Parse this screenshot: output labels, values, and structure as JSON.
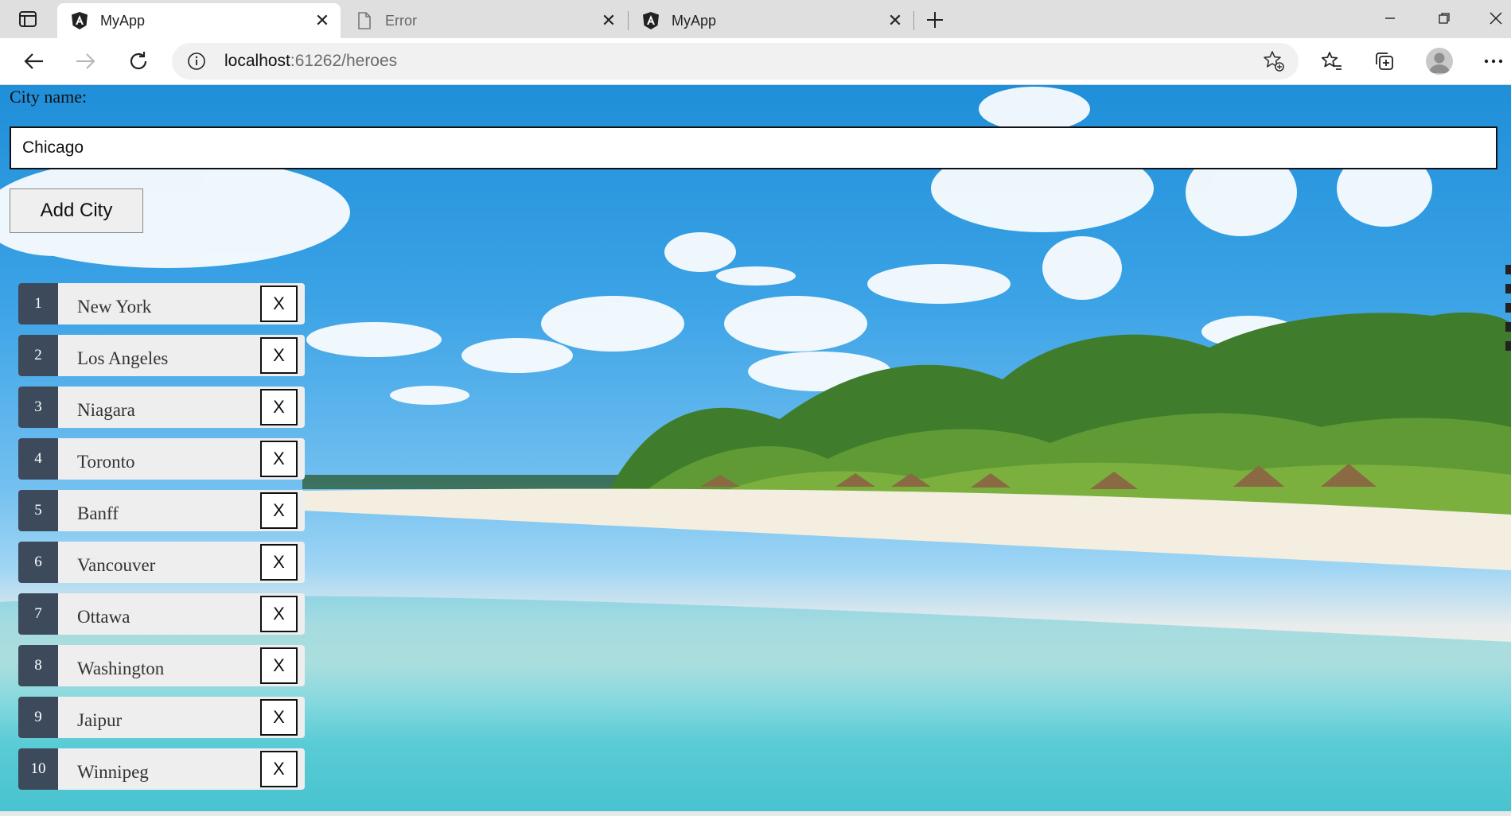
{
  "browser": {
    "tabs": [
      {
        "title": "MyApp",
        "icon": "angular-icon",
        "active": true
      },
      {
        "title": "Error",
        "icon": "page-icon",
        "active": false
      },
      {
        "title": "MyApp",
        "icon": "angular-icon",
        "active": false
      }
    ],
    "close_glyph": "✕",
    "url_host": "localhost",
    "url_rest": ":61262/heroes"
  },
  "page": {
    "city_label": "City name:",
    "city_input_value": "Chicago",
    "add_button_label": "Add City",
    "heroes": [
      {
        "id": "1",
        "name": "New York"
      },
      {
        "id": "2",
        "name": "Los Angeles"
      },
      {
        "id": "3",
        "name": "Niagara"
      },
      {
        "id": "4",
        "name": "Toronto"
      },
      {
        "id": "5",
        "name": "Banff"
      },
      {
        "id": "6",
        "name": "Vancouver"
      },
      {
        "id": "7",
        "name": "Ottawa"
      },
      {
        "id": "8",
        "name": "Washington"
      },
      {
        "id": "9",
        "name": "Jaipur"
      },
      {
        "id": "10",
        "name": "Winnipeg"
      }
    ],
    "delete_label": "X"
  },
  "colors": {
    "badge": "#3d4a5c",
    "item_bg": "#eeeeee",
    "sky": "#1f8fd9",
    "sea": "#3cbfcc"
  }
}
